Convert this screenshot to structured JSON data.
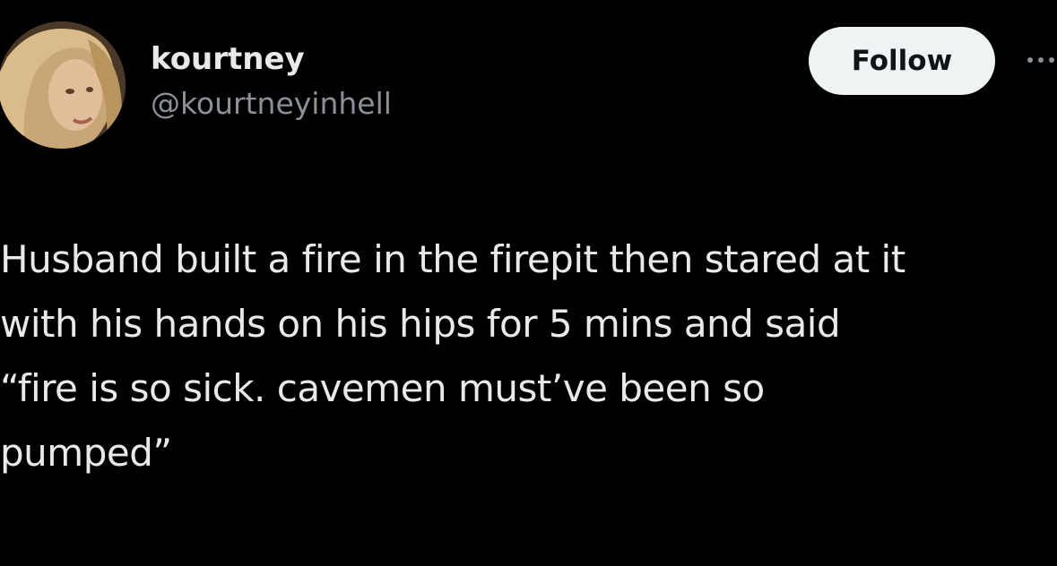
{
  "tweet": {
    "author": {
      "display_name": "kourtney",
      "handle": "@kourtneyinhell",
      "avatar_icon": "profile-photo"
    },
    "follow_label": "Follow",
    "more_icon": "more-options-icon",
    "text_lines": [
      "Husband built a fire in the firepit then stared at it",
      "with his hands on his hips for 5 mins and said",
      "“fire is so sick. cavemen must’ve been so",
      "pumped”"
    ],
    "colors": {
      "background": "#000000",
      "primary_text": "#e7e9ea",
      "secondary_text": "#8b9096",
      "follow_button_bg": "#eff3f4",
      "follow_button_text": "#0f1419"
    }
  }
}
